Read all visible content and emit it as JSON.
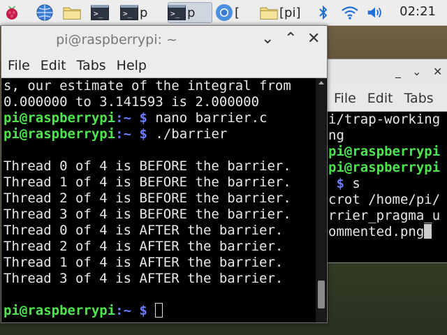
{
  "taskbar": {
    "items": [
      {
        "label": ""
      },
      {
        "label": ""
      },
      {
        "label": ""
      },
      {
        "label": ""
      },
      {
        "label": "p"
      },
      {
        "label": "p"
      },
      {
        "label": "["
      },
      {
        "label": "[pi]"
      }
    ],
    "clock": "02:21"
  },
  "main_window": {
    "title": "pi@raspberrypi: ~",
    "menu": [
      "File",
      "Edit",
      "Tabs",
      "Help"
    ],
    "lines": [
      "s, our estimate of the integral from",
      "0.000000 to 3.141593 is 2.000000",
      "",
      "",
      "",
      "Thread 0 of 4 is BEFORE the barrier.",
      "Thread 1 of 4 is BEFORE the barrier.",
      "Thread 2 of 4 is BEFORE the barrier.",
      "Thread 3 of 4 is BEFORE the barrier.",
      "Thread 0 of 4 is AFTER the barrier.",
      "Thread 2 of 4 is AFTER the barrier.",
      "Thread 1 of 4 is AFTER the barrier.",
      "Thread 3 of 4 is AFTER the barrier."
    ],
    "prompt_user": "pi@raspberrypi",
    "prompt_path": ":~ ",
    "prompt_sign": "$",
    "cmd1": " nano barrier.c",
    "cmd2": " ./barrier"
  },
  "bg_window": {
    "menu": [
      "File",
      "Edit",
      "Tabs"
    ],
    "lines": [
      "i/trap-working",
      "ng"
    ],
    "prompt_user": "pi@raspberrypi",
    "prompt_sign": "$",
    "cmd": " s",
    "out": [
      "crot /home/pi/",
      "rrier_pragma_u",
      "ommented.png"
    ]
  },
  "colors": {
    "prompt_user": "#4ee44e",
    "prompt_sign": "#6a7cff",
    "terminal_bg": "#000000"
  }
}
